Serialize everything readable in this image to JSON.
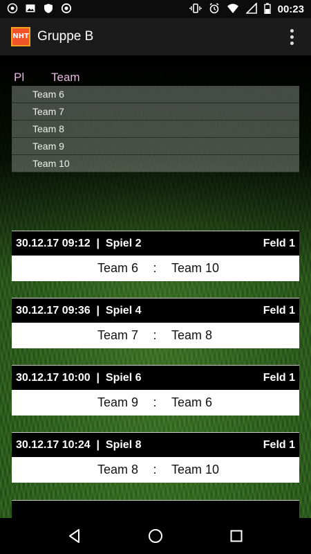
{
  "status_bar": {
    "time": "00:23",
    "left_icons": [
      "whatsapp-icon",
      "image-icon",
      "shield-icon",
      "record-icon"
    ],
    "right_icons": [
      "vibrate-icon",
      "alarm-icon",
      "wifi-icon",
      "signal-icon",
      "battery-icon"
    ]
  },
  "app_bar": {
    "title": "Gruppe B",
    "logo_text": "NHT"
  },
  "standings": {
    "col_place": "Pl",
    "col_team": "Team",
    "rows": [
      {
        "place": "",
        "team": "Team 6"
      },
      {
        "place": "",
        "team": "Team 7"
      },
      {
        "place": "",
        "team": "Team 8"
      },
      {
        "place": "",
        "team": "Team 9"
      },
      {
        "place": "",
        "team": "Team 10"
      }
    ]
  },
  "matches": [
    {
      "info": "30.12.17 09:12  |  Spiel 2",
      "field": "Feld 1",
      "home": "Team 6",
      "sep": ":",
      "away": "Team 10"
    },
    {
      "info": "30.12.17 09:36  |  Spiel 4",
      "field": "Feld 1",
      "home": "Team 7",
      "sep": ":",
      "away": "Team 8"
    },
    {
      "info": "30.12.17 10:00  |  Spiel 6",
      "field": "Feld 1",
      "home": "Team 9",
      "sep": ":",
      "away": "Team 6"
    },
    {
      "info": "30.12.17 10:24  |  Spiel 8",
      "field": "Feld 1",
      "home": "Team 8",
      "sep": ":",
      "away": "Team 10"
    }
  ],
  "colors": {
    "header_accent": "#e7b8e3",
    "app_bar": "#1b1b1b",
    "match_header": "#000000",
    "match_body": "#ffffff"
  },
  "nav_bar": {
    "icons": [
      "back-icon",
      "home-icon",
      "recents-icon"
    ]
  }
}
